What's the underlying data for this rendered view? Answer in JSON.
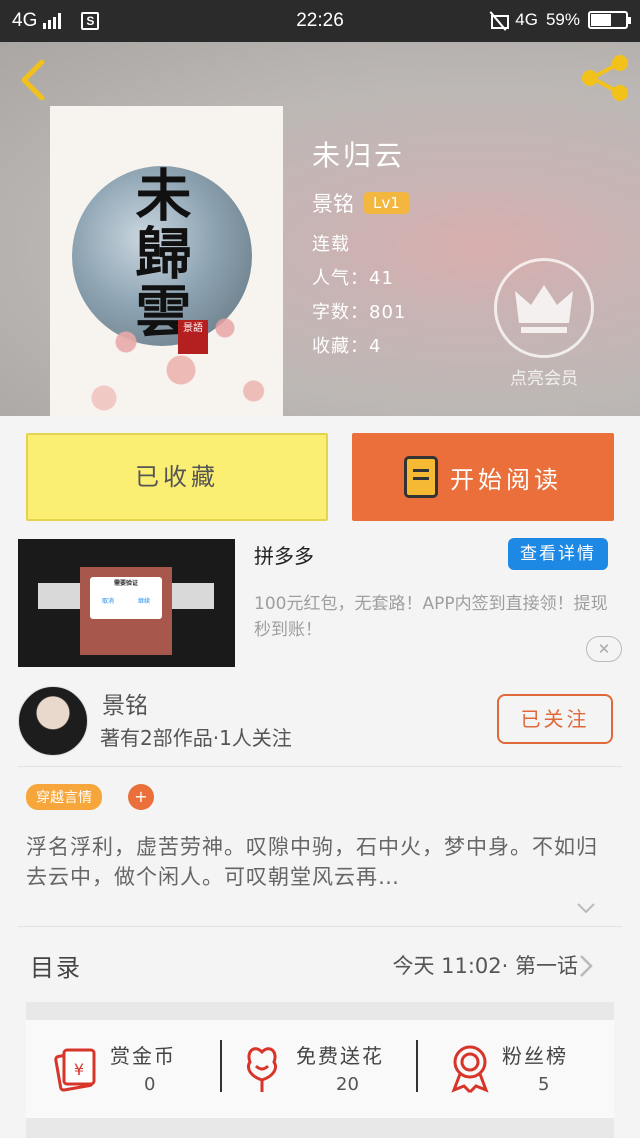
{
  "status_bar": {
    "network_left": "4G",
    "sim_icon": "sim-s-icon",
    "time": "22:26",
    "network_right": "4G",
    "battery_percent": "59%",
    "battery_level": 0.59
  },
  "header": {
    "back_icon": "chevron-left-icon",
    "share_icon": "share-icon",
    "cover_title": "未歸雲",
    "cover_seal": "景語",
    "title": "未归云",
    "author": "景铭",
    "level": "Lv1",
    "status": "连载",
    "popularity": "人气：41",
    "word_count": "字数：801",
    "favorites": "收藏：4",
    "vip_label": "点亮会员",
    "vip_icon": "crown-icon"
  },
  "actions": {
    "collected_label": "已收藏",
    "read_label": "开始阅读",
    "read_icon": "book-icon"
  },
  "ad": {
    "title": "拼多多",
    "detail_label": "查看详情",
    "description": "100元红包，无套路！APP内签到直接领！提现秒到账！",
    "close_label": "✕",
    "image_dialog_title": "需要验证",
    "image_dialog_cancel": "取消",
    "image_dialog_ok": "继续"
  },
  "author_card": {
    "name": "景铭",
    "works": "著有2部作品·1人关注",
    "follow_label": "已关注"
  },
  "tags": {
    "genre": "穿越言情",
    "add_label": "+"
  },
  "synopsis": {
    "text": "浮名浮利，虚苦劳神。叹隙中驹，石中火，梦中身。不如归去云中，做个闲人。可叹朝堂风云再…"
  },
  "toc": {
    "label": "目录",
    "latest": "今天 11:02· 第一话"
  },
  "stats": [
    {
      "label": "赏金币",
      "value": "0",
      "icon": "red-envelope-yen-icon"
    },
    {
      "label": "免费送花",
      "value": "20",
      "icon": "flower-icon"
    },
    {
      "label": "粉丝榜",
      "value": "5",
      "icon": "award-ribbon-icon"
    }
  ],
  "colors": {
    "accent_orange": "#ea6f3a",
    "collected_yellow": "#fbef73",
    "link_blue": "#1e88e5",
    "level_badge": "#f3b63f",
    "stat_icon_red": "#d8352a"
  }
}
